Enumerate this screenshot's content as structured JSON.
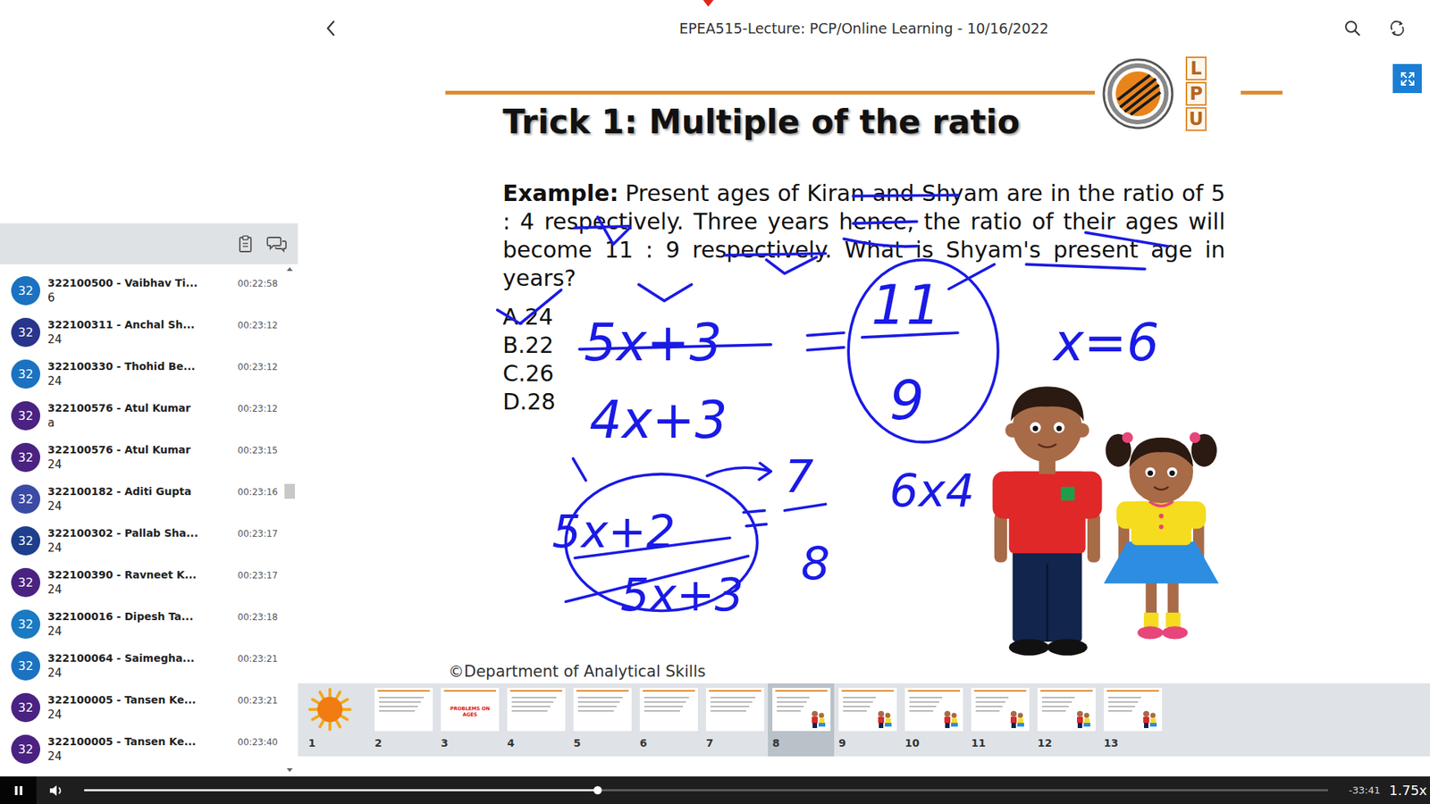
{
  "window": {
    "title": "EPEA515-Lecture: PCP/Online Learning - 10/16/2022"
  },
  "slide": {
    "title": "Trick 1: Multiple of the ratio",
    "example_label": "Example:",
    "question": "Present ages of Kiran and Shyam are in the ratio of 5 : 4 respectively. Three years hence, the ratio of their ages will become 11 : 9 respectively. What is Shyam's present age in years?",
    "options": [
      "A.24",
      "B.22",
      "C.26",
      "D.28"
    ],
    "footer": "©Department of Analytical Skills",
    "logo_letters": [
      "L",
      "P",
      "U"
    ],
    "annotations": [
      "5x+3",
      "4x+3",
      "11",
      "9",
      "x=6",
      "6x4",
      "5x+2",
      "5x+3",
      "7",
      "8"
    ]
  },
  "thumbnails": [
    {
      "number": "1",
      "kind": "image",
      "selected": false
    },
    {
      "number": "2",
      "kind": "slide",
      "selected": false
    },
    {
      "number": "3",
      "kind": "slide",
      "title": "PROBLEMS ON AGES",
      "selected": false
    },
    {
      "number": "4",
      "kind": "slide",
      "selected": false
    },
    {
      "number": "5",
      "kind": "slide",
      "selected": false
    },
    {
      "number": "6",
      "kind": "slide",
      "selected": false
    },
    {
      "number": "7",
      "kind": "slide",
      "selected": false
    },
    {
      "number": "8",
      "kind": "figure",
      "selected": true
    },
    {
      "number": "9",
      "kind": "figure",
      "selected": false
    },
    {
      "number": "10",
      "kind": "figure",
      "selected": false
    },
    {
      "number": "11",
      "kind": "figure",
      "selected": false
    },
    {
      "number": "12",
      "kind": "figure",
      "selected": false
    },
    {
      "number": "13",
      "kind": "figure",
      "selected": false
    }
  ],
  "chat": {
    "scroll": 0.44,
    "messages": [
      {
        "avatar": "32",
        "name": "322100500 - Vaibhav Ti...",
        "time": "00:22:58",
        "text": "6",
        "color": "#1b72c0"
      },
      {
        "avatar": "32",
        "name": "322100311 - Anchal Sh...",
        "time": "00:23:12",
        "text": "24",
        "color": "#28358c"
      },
      {
        "avatar": "32",
        "name": "322100330 - Thohid Be...",
        "time": "00:23:12",
        "text": "24",
        "color": "#1b72c0"
      },
      {
        "avatar": "32",
        "name": "322100576 - Atul Kumar",
        "time": "00:23:12",
        "text": "a",
        "color": "#4a2281"
      },
      {
        "avatar": "32",
        "name": "322100576 - Atul Kumar",
        "time": "00:23:15",
        "text": "24",
        "color": "#4a2281"
      },
      {
        "avatar": "32",
        "name": "322100182 - Aditi Gupta",
        "time": "00:23:16",
        "text": "24",
        "color": "#3b4aa5"
      },
      {
        "avatar": "32",
        "name": "322100302 - Pallab Sha...",
        "time": "00:23:17",
        "text": "24",
        "color": "#1d3f8c"
      },
      {
        "avatar": "32",
        "name": "322100390 - Ravneet K...",
        "time": "00:23:17",
        "text": "24",
        "color": "#4a2281"
      },
      {
        "avatar": "32",
        "name": "322100016 - Dipesh Ta...",
        "time": "00:23:18",
        "text": "24",
        "color": "#1a7ac2"
      },
      {
        "avatar": "32",
        "name": "322100064 - Saimegha...",
        "time": "00:23:21",
        "text": "24",
        "color": "#1b72c0"
      },
      {
        "avatar": "32",
        "name": "322100005 - Tansen Ke...",
        "time": "00:23:21",
        "text": "24",
        "color": "#4a2281"
      },
      {
        "avatar": "32",
        "name": "322100005 - Tansen Ke...",
        "time": "00:23:40",
        "text": "24",
        "color": "#4a2281"
      }
    ]
  },
  "player": {
    "playing": true,
    "progress": 0.413,
    "remaining": "-33:41",
    "speed": "1.75x"
  }
}
